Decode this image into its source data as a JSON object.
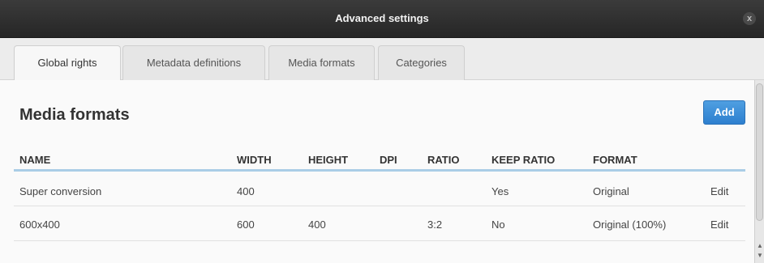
{
  "dialog": {
    "title": "Advanced settings",
    "close_label": "x"
  },
  "tabs": [
    {
      "label": "Global rights"
    },
    {
      "label": "Metadata definitions"
    },
    {
      "label": "Media formats"
    },
    {
      "label": "Categories"
    }
  ],
  "main": {
    "heading": "Media formats",
    "add_label": "Add",
    "columns": [
      "NAME",
      "WIDTH",
      "HEIGHT",
      "DPI",
      "RATIO",
      "KEEP RATIO",
      "FORMAT"
    ],
    "rows": [
      {
        "name": "Super conversion",
        "width": "400",
        "height": "",
        "dpi": "",
        "ratio": "",
        "keep_ratio": "Yes",
        "format": "Original",
        "edit": "Edit"
      },
      {
        "name": "600x400",
        "width": "600",
        "height": "400",
        "dpi": "",
        "ratio": "3:2",
        "keep_ratio": "No",
        "format": "Original (100%)",
        "edit": "Edit"
      }
    ]
  },
  "colors": {
    "titlebar": "#2f2f2f",
    "accent_button": "#3a8ad6",
    "header_rule": "#aacde6"
  },
  "icons": {
    "close": "close-icon",
    "scroll_up": "chevron-up-icon",
    "scroll_down": "chevron-down-icon"
  }
}
